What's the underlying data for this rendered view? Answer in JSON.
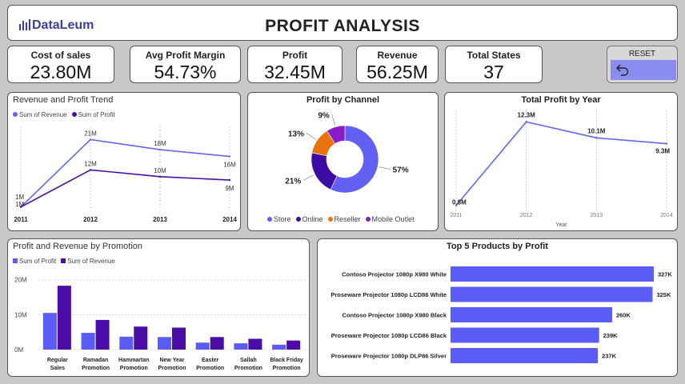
{
  "header": {
    "logo_text": "DataLeum",
    "title": "PROFIT ANALYSIS"
  },
  "kpis": [
    {
      "label": "Cost of sales",
      "value": "23.80M"
    },
    {
      "label": "Avg Profit Margin",
      "value": "54.73%"
    },
    {
      "label": "Profit",
      "value": "32.45M"
    },
    {
      "label": "Revenue",
      "value": "56.25M"
    },
    {
      "label": "Total States",
      "value": "37"
    }
  ],
  "reset": {
    "label": "RESET",
    "icon": "undo-arrow-icon"
  },
  "colors": {
    "revenue": "#6366f1",
    "profit": "#4a0ea6",
    "bar_blue": "#5b5bf5",
    "store": "#6160f2",
    "online": "#3c0ca3",
    "reseller": "#e8730c",
    "mobile": "#8a1bc9"
  },
  "chart_data": [
    {
      "type": "line",
      "title": "Revenue and Profit Trend",
      "x": [
        "2011",
        "2012",
        "2013",
        "2014"
      ],
      "series": [
        {
          "name": "Sum of Revenue",
          "values": [
            1,
            21,
            18,
            16
          ],
          "labels": [
            "1M",
            "21M",
            "18M",
            "16M"
          ]
        },
        {
          "name": "Sum of Profit",
          "values": [
            1,
            12,
            10,
            9
          ],
          "labels": [
            "1M",
            "12M",
            "10M",
            "9M"
          ]
        }
      ],
      "ylim": [
        0,
        23
      ]
    },
    {
      "type": "pie",
      "title": "Profit by Channel",
      "slices": [
        {
          "name": "Store",
          "value": 57,
          "label": "57%"
        },
        {
          "name": "Online",
          "value": 21,
          "label": "21%"
        },
        {
          "name": "Reseller",
          "value": 13,
          "label": "13%"
        },
        {
          "name": "Mobile Outlet",
          "value": 9,
          "label": "9%"
        }
      ]
    },
    {
      "type": "line",
      "title": "Total Profit by Year",
      "xlabel": "Year",
      "x": [
        "2011",
        "2012",
        "2013",
        "2014"
      ],
      "series": [
        {
          "values": [
            0.8,
            12.3,
            10.1,
            9.3
          ],
          "labels": [
            "0.8M",
            "12.3M",
            "10.1M",
            "9.3M"
          ]
        }
      ],
      "ylim": [
        0,
        13
      ]
    },
    {
      "type": "bar",
      "title": "Profit and Revenue by Promotion",
      "categories": [
        "Regular Sales",
        "Ramadan Promotion",
        "Hammartan Promotion",
        "New Year Promotion",
        "Easter Promotion",
        "Sallah Promotion",
        "Black Friday Promotion"
      ],
      "category_lines": [
        [
          "Regular",
          "Sales"
        ],
        [
          "Ramadan",
          "Promotion"
        ],
        [
          "Hammartan",
          "Promotion"
        ],
        [
          "New Year",
          "Promotion"
        ],
        [
          "Easter",
          "Promotion"
        ],
        [
          "Sallah",
          "Promotion"
        ],
        [
          "Black Friday",
          "Promotion"
        ]
      ],
      "series": [
        {
          "name": "Sum of Profit",
          "values": [
            10.5,
            4.8,
            3.7,
            3.6,
            2.0,
            1.8,
            1.4
          ]
        },
        {
          "name": "Sum of Revenue",
          "values": [
            18.3,
            8.5,
            6.6,
            6.3,
            3.6,
            3.1,
            2.6
          ]
        }
      ],
      "yticks": [
        "0M",
        "10M",
        "20M"
      ],
      "ylim": [
        0,
        22
      ]
    },
    {
      "type": "bar",
      "title": "Top 5 Products by Profit",
      "categories": [
        "Contoso Projector 1080p X980 White",
        "Proseware Projector 1080p LCD86 White",
        "Contoso Projector 1080p X980 Black",
        "Proseware Projector 1080p LCD86 Black",
        "Proseware Projector 1080p DLP86 Silver"
      ],
      "values": [
        327,
        325,
        260,
        239,
        237
      ],
      "labels": [
        "327K",
        "325K",
        "260K",
        "239K",
        "237K"
      ],
      "xlim": [
        0,
        327
      ]
    }
  ]
}
